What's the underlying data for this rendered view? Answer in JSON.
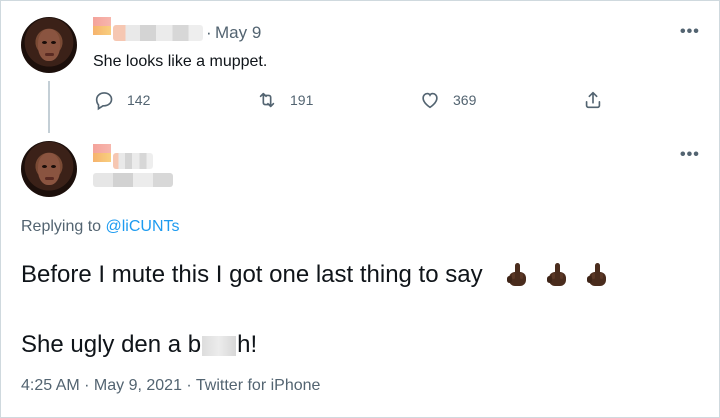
{
  "tweet1": {
    "date": "May 9",
    "separator": "·",
    "text": "She looks like a muppet.",
    "more": "•••",
    "counts": {
      "replies": "142",
      "retweets": "191",
      "likes": "369"
    }
  },
  "tweet2": {
    "more": "•••",
    "replying_prefix": "Replying to ",
    "replying_handle": "@liCUNTs",
    "line1": "Before I mute this I got one last thing to say",
    "line2_before": "She ugly den a b",
    "line2_after": "h!",
    "footer": "4:25 AM · May 9, 2021 · Twitter for iPhone"
  },
  "colors": {
    "link": "#1d9bf0",
    "secondary_text": "#536471",
    "border": "#cfd9de"
  },
  "icons": [
    "reply-icon",
    "retweet-icon",
    "like-icon",
    "share-icon",
    "more-icon",
    "middle-finger-emoji"
  ]
}
